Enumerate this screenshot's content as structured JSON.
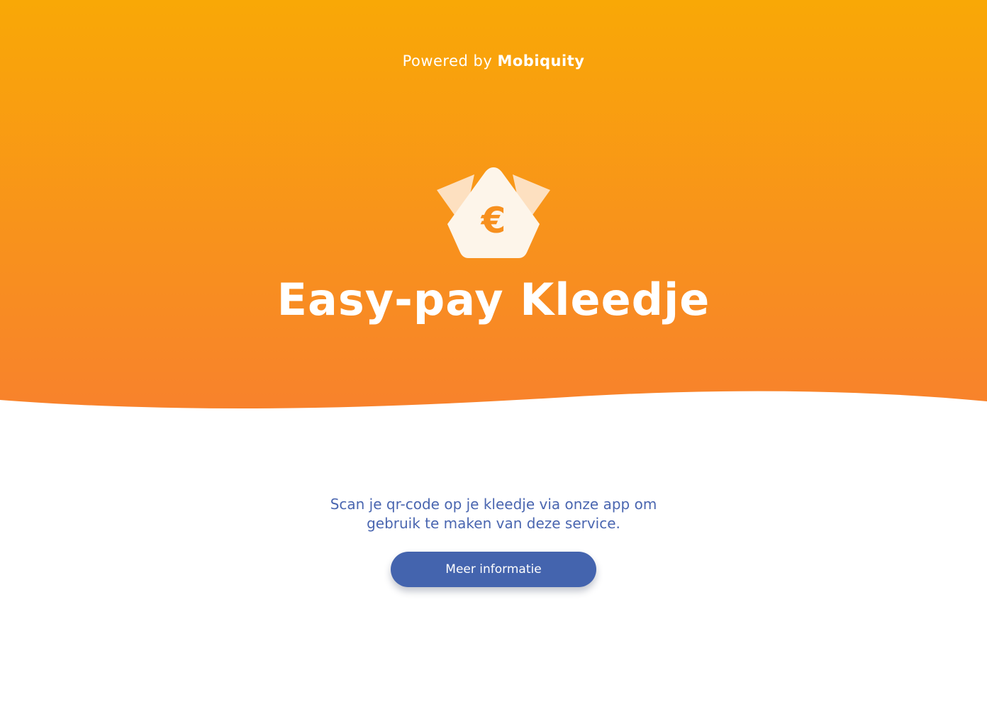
{
  "header": {
    "powered_prefix": "Powered by",
    "powered_brand": "Mobiquity"
  },
  "hero": {
    "title": "Easy-pay Kleedje",
    "logo_icon": "crown-euro-icon",
    "logo_symbol": "€",
    "gradient_top": "#f9a806",
    "gradient_bottom": "#f8822c"
  },
  "main": {
    "description": "Scan je qr-code op je kleedje via onze app om gebruik te maken van deze service.",
    "cta_label": "Meer informatie"
  },
  "colors": {
    "primary_blue": "#4464ae",
    "text_blue": "#4a66b0"
  }
}
